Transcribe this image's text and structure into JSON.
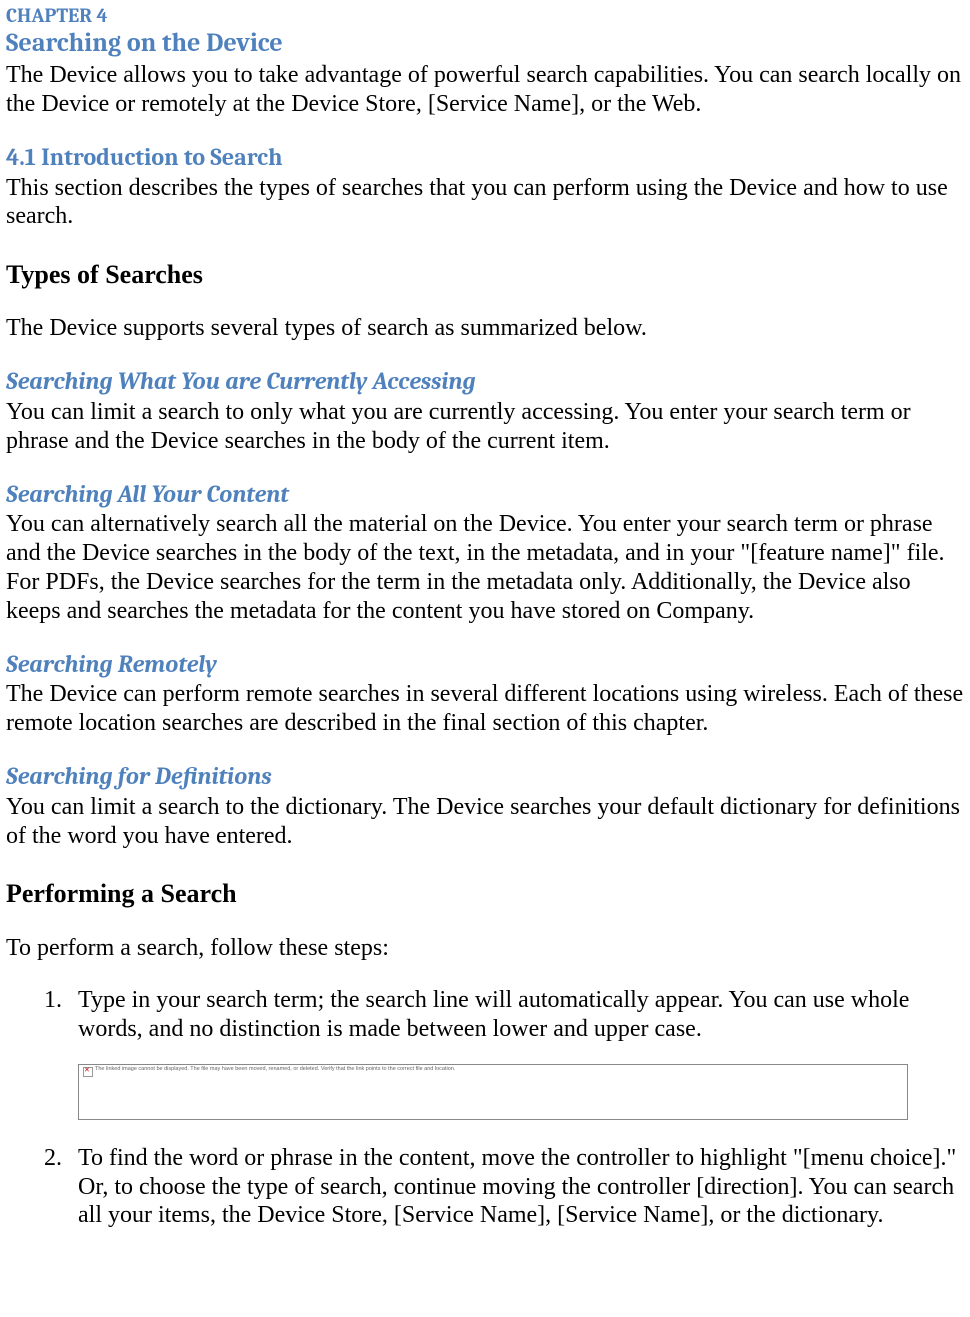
{
  "chapter": {
    "label": "CHAPTER 4",
    "title": "Searching on the Device",
    "intro": "The Device allows you to take advantage of powerful search capabilities. You can search locally on the Device or remotely at the Device Store, [Service Name], or the Web."
  },
  "section41": {
    "heading": "4.1 Introduction to Search",
    "intro": "This section describes the types of searches that you can perform using the Device and how to use search.",
    "types_heading": "Types of Searches",
    "types_intro": "The Device supports several types of search as summarized below.",
    "sub1": {
      "heading": "Searching What You are Currently Accessing",
      "body": "You can limit a search to only what you are currently accessing. You enter your search term or phrase and the Device searches in the body of the current item."
    },
    "sub2": {
      "heading": "Searching All Your Content",
      "body": "You can alternatively search all the material on the Device. You enter your search term or phrase and the Device searches in the body of the text, in the metadata, and in your \"[feature name]\" file. For PDFs, the Device searches for the term in the metadata only. Additionally, the Device also keeps and searches the metadata for the content you have stored on Company."
    },
    "sub3": {
      "heading": "Searching Remotely",
      "body": "The Device can perform remote searches in several different locations using wireless. Each of these remote location searches are described in the final section of this chapter."
    },
    "sub4": {
      "heading": "Searching for Definitions",
      "body": "You can limit a search to the dictionary. The Device searches your default dictionary for definitions of the word you have entered."
    },
    "perform_heading": "Performing a Search",
    "perform_intro": "To perform a search, follow these steps:",
    "steps": {
      "s1": "Type in your search term; the search line will automatically appear. You can use whole words, and no distinction is made between lower and upper case.",
      "s2": "To find the word or phrase in the content, move the controller to highlight \"[menu choice].\" Or, to choose the type of search, continue moving the controller [direction]. You can search all your items, the Device Store, [Service Name], [Service Name], or the dictionary."
    },
    "placeholder_text": "The linked image cannot be displayed. The file may have been moved, renamed, or deleted. Verify that the link points to the correct file and location."
  }
}
